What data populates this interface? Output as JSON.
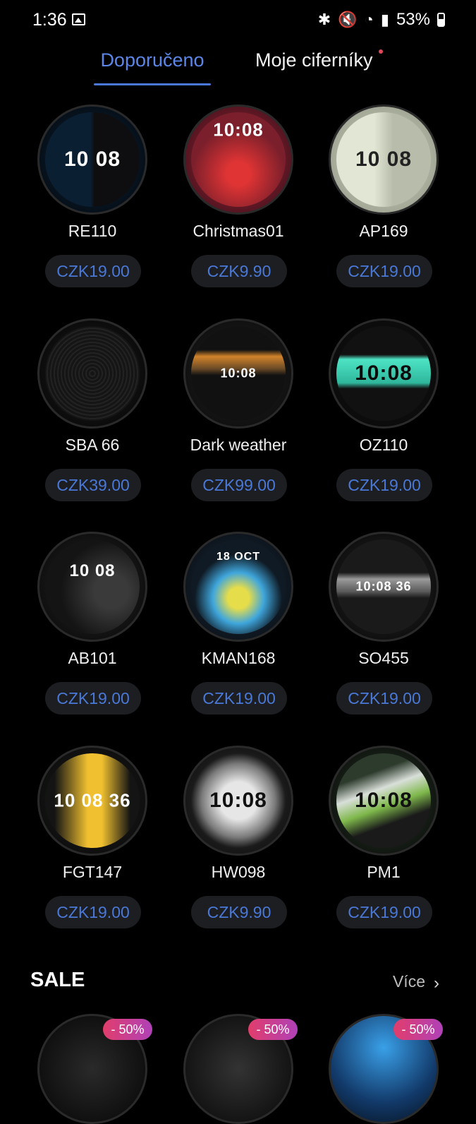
{
  "status": {
    "time": "1:36",
    "battery": "53%"
  },
  "tabs": [
    {
      "label": "Doporučeno",
      "active": true
    },
    {
      "label": "Moje ciferníky",
      "active": false
    }
  ],
  "items": [
    {
      "name": "RE110",
      "price": "CZK19.00",
      "face_text": "10 08"
    },
    {
      "name": "Christmas01",
      "price": "CZK9.90",
      "face_text": "10:08"
    },
    {
      "name": "AP169",
      "price": "CZK19.00",
      "face_text": "10 08"
    },
    {
      "name": "SBA 66",
      "price": "CZK39.00",
      "face_text": ""
    },
    {
      "name": "Dark weather",
      "price": "CZK99.00",
      "face_text": "10:08"
    },
    {
      "name": "OZ110",
      "price": "CZK19.00",
      "face_text": "10:08"
    },
    {
      "name": "AB101",
      "price": "CZK19.00",
      "face_text": "10 08"
    },
    {
      "name": "KMAN168",
      "price": "CZK19.00",
      "face_text": "18 OCT"
    },
    {
      "name": "SO455",
      "price": "CZK19.00",
      "face_text": "10:08 36"
    },
    {
      "name": "FGT147",
      "price": "CZK19.00",
      "face_text": "10 08 36"
    },
    {
      "name": "HW098",
      "price": "CZK9.90",
      "face_text": "10:08"
    },
    {
      "name": "PM1",
      "price": "CZK19.00",
      "face_text": "10:08"
    }
  ],
  "sale": {
    "title": "SALE",
    "more_label": "Více",
    "badges": [
      "- 50%",
      "- 50%",
      "- 50%"
    ]
  },
  "colors": {
    "accent": "#5b86e8",
    "price_text": "#4a78d6",
    "pill_bg": "#1c1e22",
    "badge_start": "#e13d6b",
    "badge_end": "#b041b8"
  },
  "icons": {
    "status": [
      "image-icon",
      "bluetooth-icon",
      "mute-icon",
      "wifi-icon",
      "signal-icon",
      "battery-icon"
    ],
    "more": "chevron-right-icon"
  }
}
